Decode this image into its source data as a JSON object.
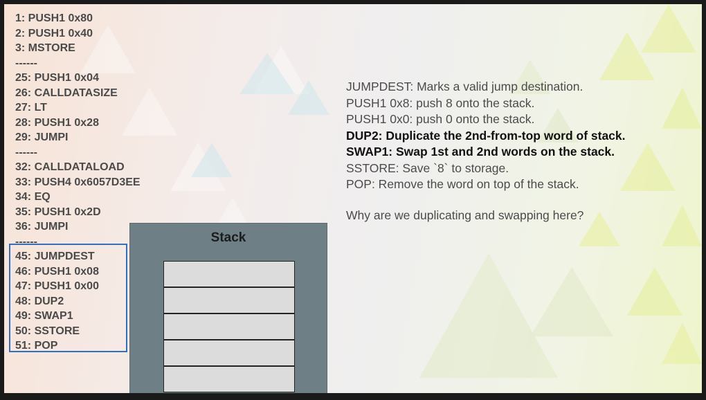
{
  "code_lines": [
    "1: PUSH1 0x80",
    "2: PUSH1 0x40",
    "3: MSTORE",
    "------",
    "25: PUSH1 0x04",
    "26: CALLDATASIZE",
    "27: LT",
    "28: PUSH1 0x28",
    "29: JUMPI",
    "------",
    "32: CALLDATALOAD",
    "33: PUSH4 0x6057D3EE",
    "34: EQ",
    "35: PUSH1 0x2D",
    "36: JUMPI",
    "------",
    "45: JUMPDEST",
    "46: PUSH1 0x08",
    "47: PUSH1 0x00",
    "48: DUP2",
    "49: SWAP1",
    "50: SSTORE",
    "51: POP"
  ],
  "stack": {
    "title": "Stack",
    "slot_count": 5
  },
  "notes": [
    {
      "text": "JUMPDEST: Marks a valid jump destination.",
      "bold": false
    },
    {
      "text": "PUSH1 0x8: push 8 onto the stack.",
      "bold": false
    },
    {
      "text": "PUSH1 0x0: push 0 onto the stack.",
      "bold": false
    },
    {
      "text": "DUP2: Duplicate the 2nd-from-top word of stack.",
      "bold": true
    },
    {
      "text": "SWAP1: Swap 1st and 2nd words on the stack.",
      "bold": true
    },
    {
      "text": "SSTORE: Save `8` to storage.",
      "bold": false
    },
    {
      "text": "POP: Remove the word on top of the stack.",
      "bold": false
    }
  ],
  "question": "Why are we duplicating and swapping here?",
  "colors": {
    "highlight_border": "#2f6fc4",
    "stack_panel": "#6f7f86",
    "stack_slot": "#dcdcdc",
    "frame": "#1a1a1a"
  }
}
